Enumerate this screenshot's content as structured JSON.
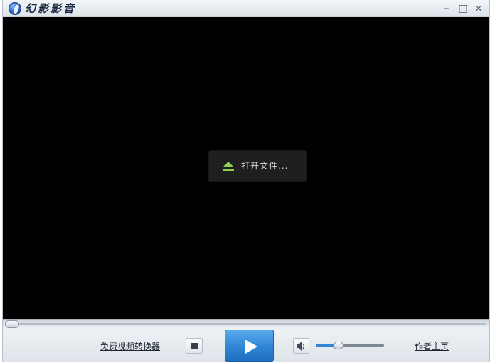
{
  "app": {
    "title": "幻影影音",
    "window_controls": {
      "minimize": "–",
      "maximize": "□",
      "close": "×"
    }
  },
  "video": {
    "open_file_label": "打开文件...",
    "open_file_icon": "eject-icon",
    "eject_color": "#8fd14f"
  },
  "seek": {
    "progress": 0
  },
  "controls": {
    "converter_link": "免费视频转换器",
    "homepage_link": "作者主页",
    "stop_icon": "stop-icon",
    "play_icon": "play-icon",
    "volume_icon": "speaker-icon",
    "volume_level": 0.33,
    "accent_color": "#2f86d6"
  }
}
